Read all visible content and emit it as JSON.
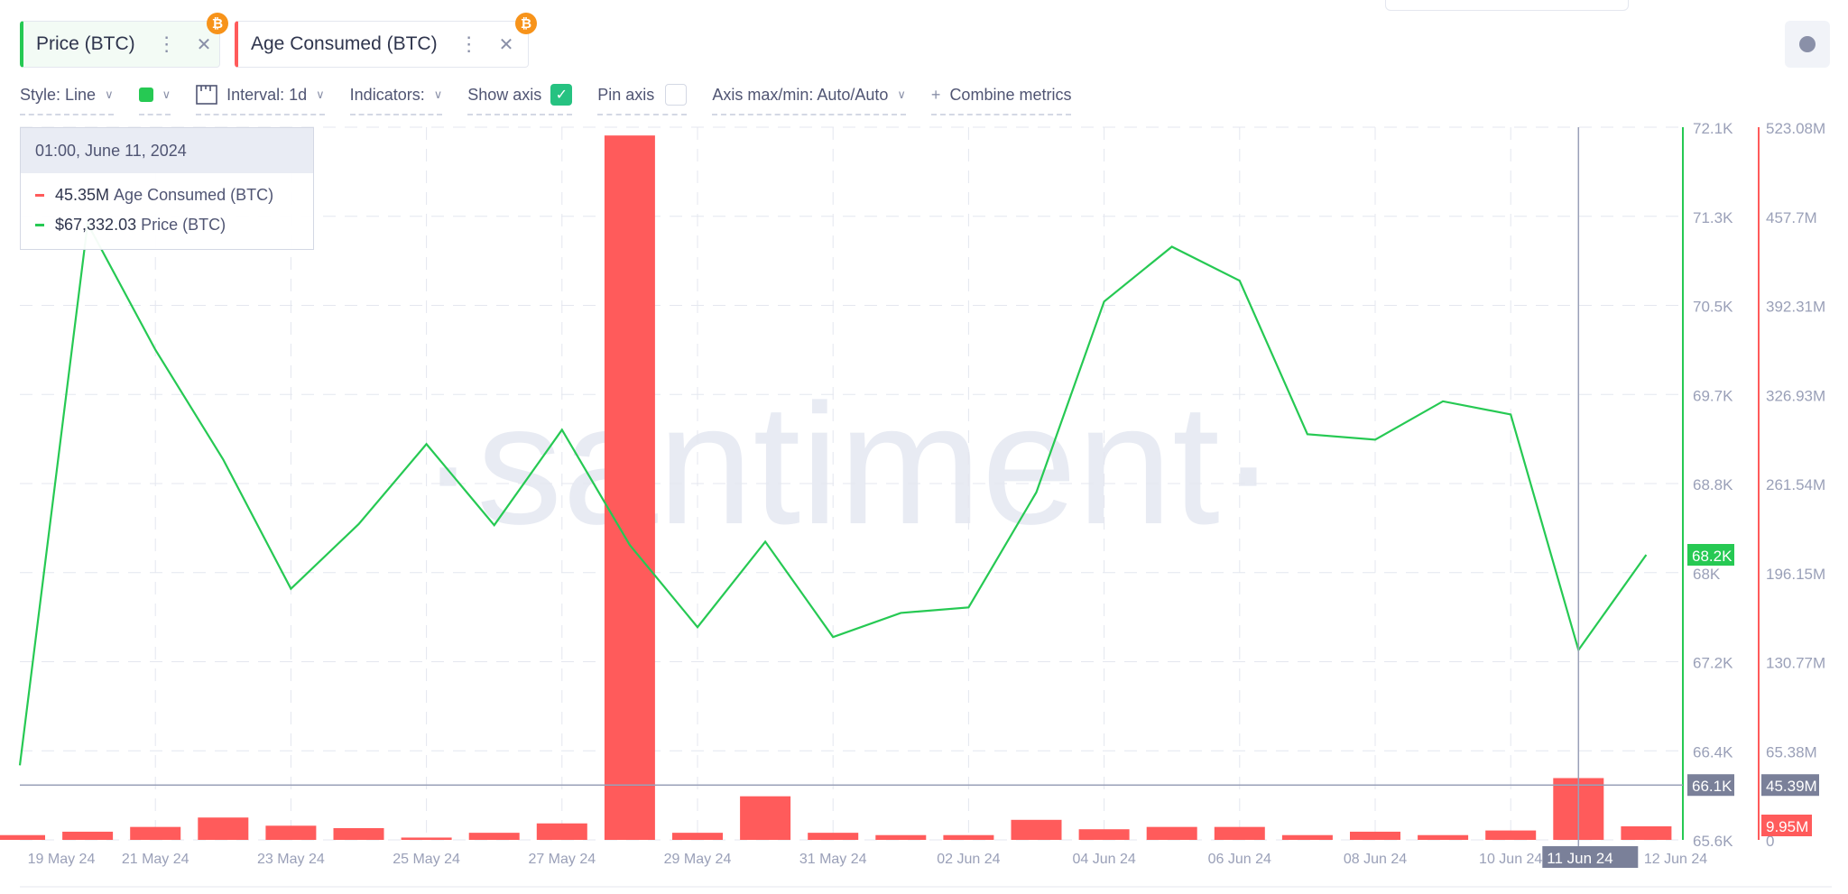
{
  "tabs": [
    {
      "label": "Price (BTC)",
      "color": "#26c953",
      "icon": "bitcoin-icon"
    },
    {
      "label": "Age Consumed (BTC)",
      "color": "#ff5b5b",
      "icon": "bitcoin-icon"
    }
  ],
  "toolbar": {
    "style": "Style: Line",
    "color": "#26c953",
    "interval": "Interval: 1d",
    "indicators": "Indicators:",
    "show_axis": "Show axis",
    "show_axis_checked": true,
    "pin_axis": "Pin axis",
    "pin_axis_checked": false,
    "axis_maxmin": "Axis max/min: Auto/Auto",
    "combine": "Combine metrics"
  },
  "tooltip": {
    "date": "01:00, June 11, 2024",
    "rows": [
      {
        "value": "45.35M",
        "label": "Age Consumed (BTC)",
        "color": "#ff5b5b"
      },
      {
        "value": "$67,332.03",
        "label": "Price (BTC)",
        "color": "#26c953"
      }
    ]
  },
  "watermark": "santiment",
  "chart_data": {
    "type": "line+bar",
    "x": [
      "19 May",
      "20 May",
      "21 May",
      "22 May",
      "23 May",
      "24 May",
      "25 May",
      "26 May",
      "27 May",
      "28 May",
      "29 May",
      "30 May",
      "31 May",
      "01 Jun",
      "02 Jun",
      "03 Jun",
      "04 Jun",
      "05 Jun",
      "06 Jun",
      "07 Jun",
      "08 Jun",
      "09 Jun",
      "10 Jun",
      "11 Jun",
      "12 Jun"
    ],
    "x_tick_labels": [
      "19 May 24",
      "21 May 24",
      "23 May 24",
      "25 May 24",
      "27 May 24",
      "29 May 24",
      "31 May 24",
      "02 Jun 24",
      "04 Jun 24",
      "06 Jun 24",
      "08 Jun 24",
      "10 Jun 24",
      "11 Jun 24",
      "12 Jun 24"
    ],
    "x_tick_index": [
      0,
      2,
      4,
      6,
      8,
      10,
      12,
      14,
      16,
      18,
      20,
      22,
      23,
      24
    ],
    "series": [
      {
        "name": "Price (BTC)",
        "type": "line",
        "color": "#26c953",
        "axis": "left",
        "values": [
          66280,
          71220,
          70070,
          69070,
          67890,
          68480,
          69210,
          68470,
          69340,
          68290,
          67540,
          68320,
          67450,
          67670,
          67720,
          68770,
          70510,
          71010,
          70700,
          69300,
          69250,
          69600,
          69480,
          67332,
          68200
        ]
      },
      {
        "name": "Age Consumed (BTC)",
        "type": "bar",
        "color": "#ff5b5b",
        "axis": "right",
        "values": [
          3.5,
          6,
          9.5,
          16.4,
          10.4,
          8.6,
          1.7,
          5.2,
          12.1,
          517,
          5.2,
          32,
          5.2,
          3.5,
          3.5,
          14.7,
          7.8,
          9.5,
          9.5,
          3.5,
          6,
          3.5,
          6.9,
          45.35,
          9.95
        ]
      }
    ],
    "price_axis": {
      "range": [
        65600,
        72100
      ],
      "ticks": [
        "72.1K",
        "71.3K",
        "70.5K",
        "69.7K",
        "68.8K",
        "68K",
        "67.2K",
        "66.4K",
        "65.6K"
      ],
      "last_label": "68.2K",
      "cursor_label": "66.1K",
      "cursor_value": 66100
    },
    "age_axis": {
      "unit": "M",
      "range": [
        0,
        523.08
      ],
      "ticks": [
        "523.08M",
        "457.7M",
        "392.31M",
        "326.93M",
        "261.54M",
        "196.15M",
        "130.77M",
        "65.38M",
        "0"
      ],
      "last_label": "9.95M",
      "cursor_label": "45.39M"
    },
    "crosshair_index": 23,
    "crosshair_label": "11 Jun 24",
    "grid": true
  }
}
